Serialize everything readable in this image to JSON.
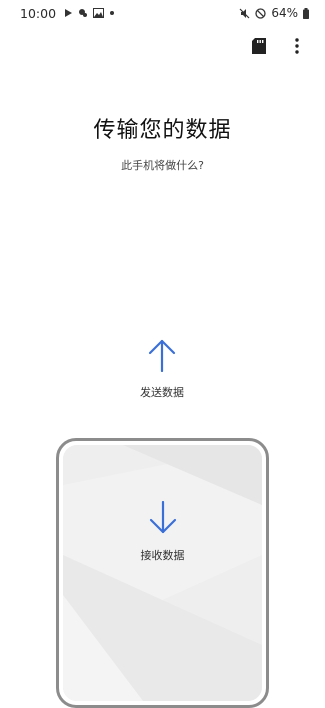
{
  "status_bar": {
    "time": "10:00",
    "battery": "64%",
    "left_icons": [
      "play-store-icon",
      "location-icon",
      "gallery-icon",
      "dot-icon"
    ],
    "right_icons": [
      "mute-icon",
      "do-not-disturb-icon",
      "battery-icon"
    ]
  },
  "toolbar": {
    "icons": [
      "sd-card-icon",
      "more-options-icon"
    ]
  },
  "main": {
    "title": "传输您的数据",
    "subtitle": "此手机将做什么?",
    "send_label": "发送数据",
    "receive_label": "接收数据"
  },
  "colors": {
    "accent": "#3b6fd8",
    "phone_border": "#8c8c8c",
    "phone_screen": "#efefef"
  }
}
